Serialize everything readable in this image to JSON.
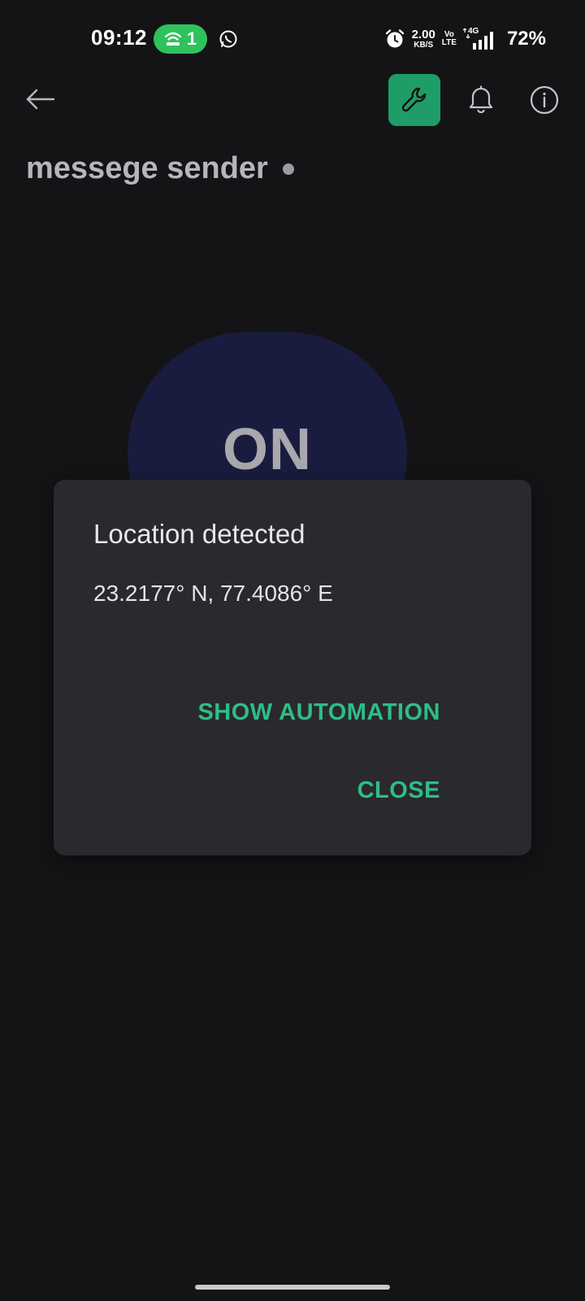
{
  "status_bar": {
    "time": "09:12",
    "hotspot_count": "1",
    "speed_value": "2.00",
    "speed_unit": "KB/S",
    "volte_top": "Vo",
    "volte_bottom": "LTE",
    "network_label": "4G",
    "battery": "72%",
    "icons": [
      "hotspot-icon",
      "whatsapp-icon",
      "alarm-icon",
      "signal-icon"
    ]
  },
  "toolbar": {
    "back_icon": "arrow-left-icon",
    "tool_icon": "wrench-icon",
    "bell_icon": "bell-icon",
    "info_icon": "info-icon"
  },
  "page": {
    "title": "messege sender"
  },
  "device_button": {
    "label": "ON"
  },
  "dialog": {
    "title": "Location detected",
    "message": "23.2177° N, 77.4086° E",
    "actions": {
      "show_automation": "SHOW AUTOMATION",
      "close": "CLOSE"
    }
  },
  "colors": {
    "background": "#141416",
    "dialog": "#29292e",
    "accent": "#2ebd86",
    "tool_button": "#1f9d66",
    "on_button": "#1a1c3f",
    "status_pill": "#2fc25b"
  }
}
